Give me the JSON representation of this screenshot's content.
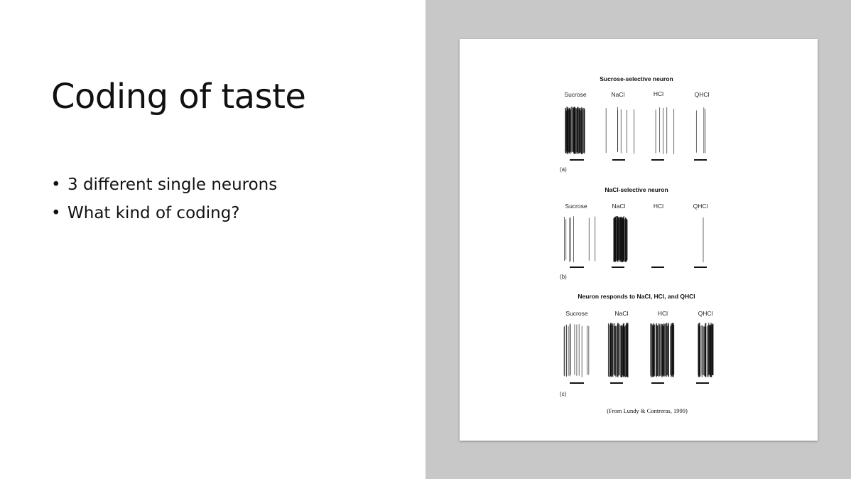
{
  "slide": {
    "title": "Coding of taste",
    "bullets": [
      "3 different single neurons",
      "What kind of coding?"
    ],
    "bullet_char": "•"
  },
  "figure": {
    "stimuli": [
      "Sucrose",
      "NaCl",
      "HCl",
      "QHCl"
    ],
    "panels": [
      {
        "title": "Sucrose-selective neuron",
        "label": "(a)",
        "density": [
          60,
          6,
          5,
          3
        ]
      },
      {
        "title": "NaCl-selective neuron",
        "label": "(b)",
        "density": [
          7,
          55,
          0,
          1
        ]
      },
      {
        "title": "Neuron responds to NaCl, HCl, and QHCl",
        "label": "(c)",
        "density": [
          14,
          48,
          60,
          34
        ]
      }
    ],
    "credit": "(From Lundy & Contreras, 1999)",
    "colors": {
      "background": "#c7c8c7",
      "ink": "#111111"
    }
  }
}
